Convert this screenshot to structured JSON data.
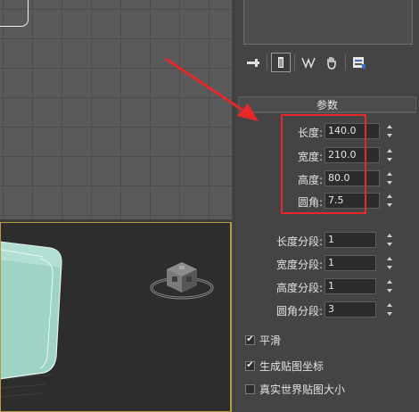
{
  "viewports": {
    "top": {},
    "perspective": {}
  },
  "toolbar": {
    "icons": [
      "pin-stack-icon",
      "show-end-result-icon",
      "make-unique-icon",
      "remove-modifier-icon",
      "configure-modifier-sets-icon"
    ]
  },
  "rollout": {
    "title": "参数"
  },
  "params": [
    {
      "label": "长度:",
      "value": "140.0"
    },
    {
      "label": "宽度:",
      "value": "210.0"
    },
    {
      "label": "高度:",
      "value": "80.0"
    },
    {
      "label": "圆角:",
      "value": "7.5"
    }
  ],
  "segments": [
    {
      "label": "长度分段:",
      "value": "1"
    },
    {
      "label": "宽度分段:",
      "value": "1"
    },
    {
      "label": "高度分段:",
      "value": "1"
    },
    {
      "label": "圆角分段:",
      "value": "3"
    }
  ],
  "options": [
    {
      "label": "平滑",
      "checked": true
    },
    {
      "label": "生成贴图坐标",
      "checked": true
    },
    {
      "label": "真实世界贴图大小",
      "checked": false
    }
  ],
  "colors": {
    "highlight": "#e8272a",
    "viewport_active_border": "#b99b3a",
    "box_color": "#a8d8cc"
  }
}
